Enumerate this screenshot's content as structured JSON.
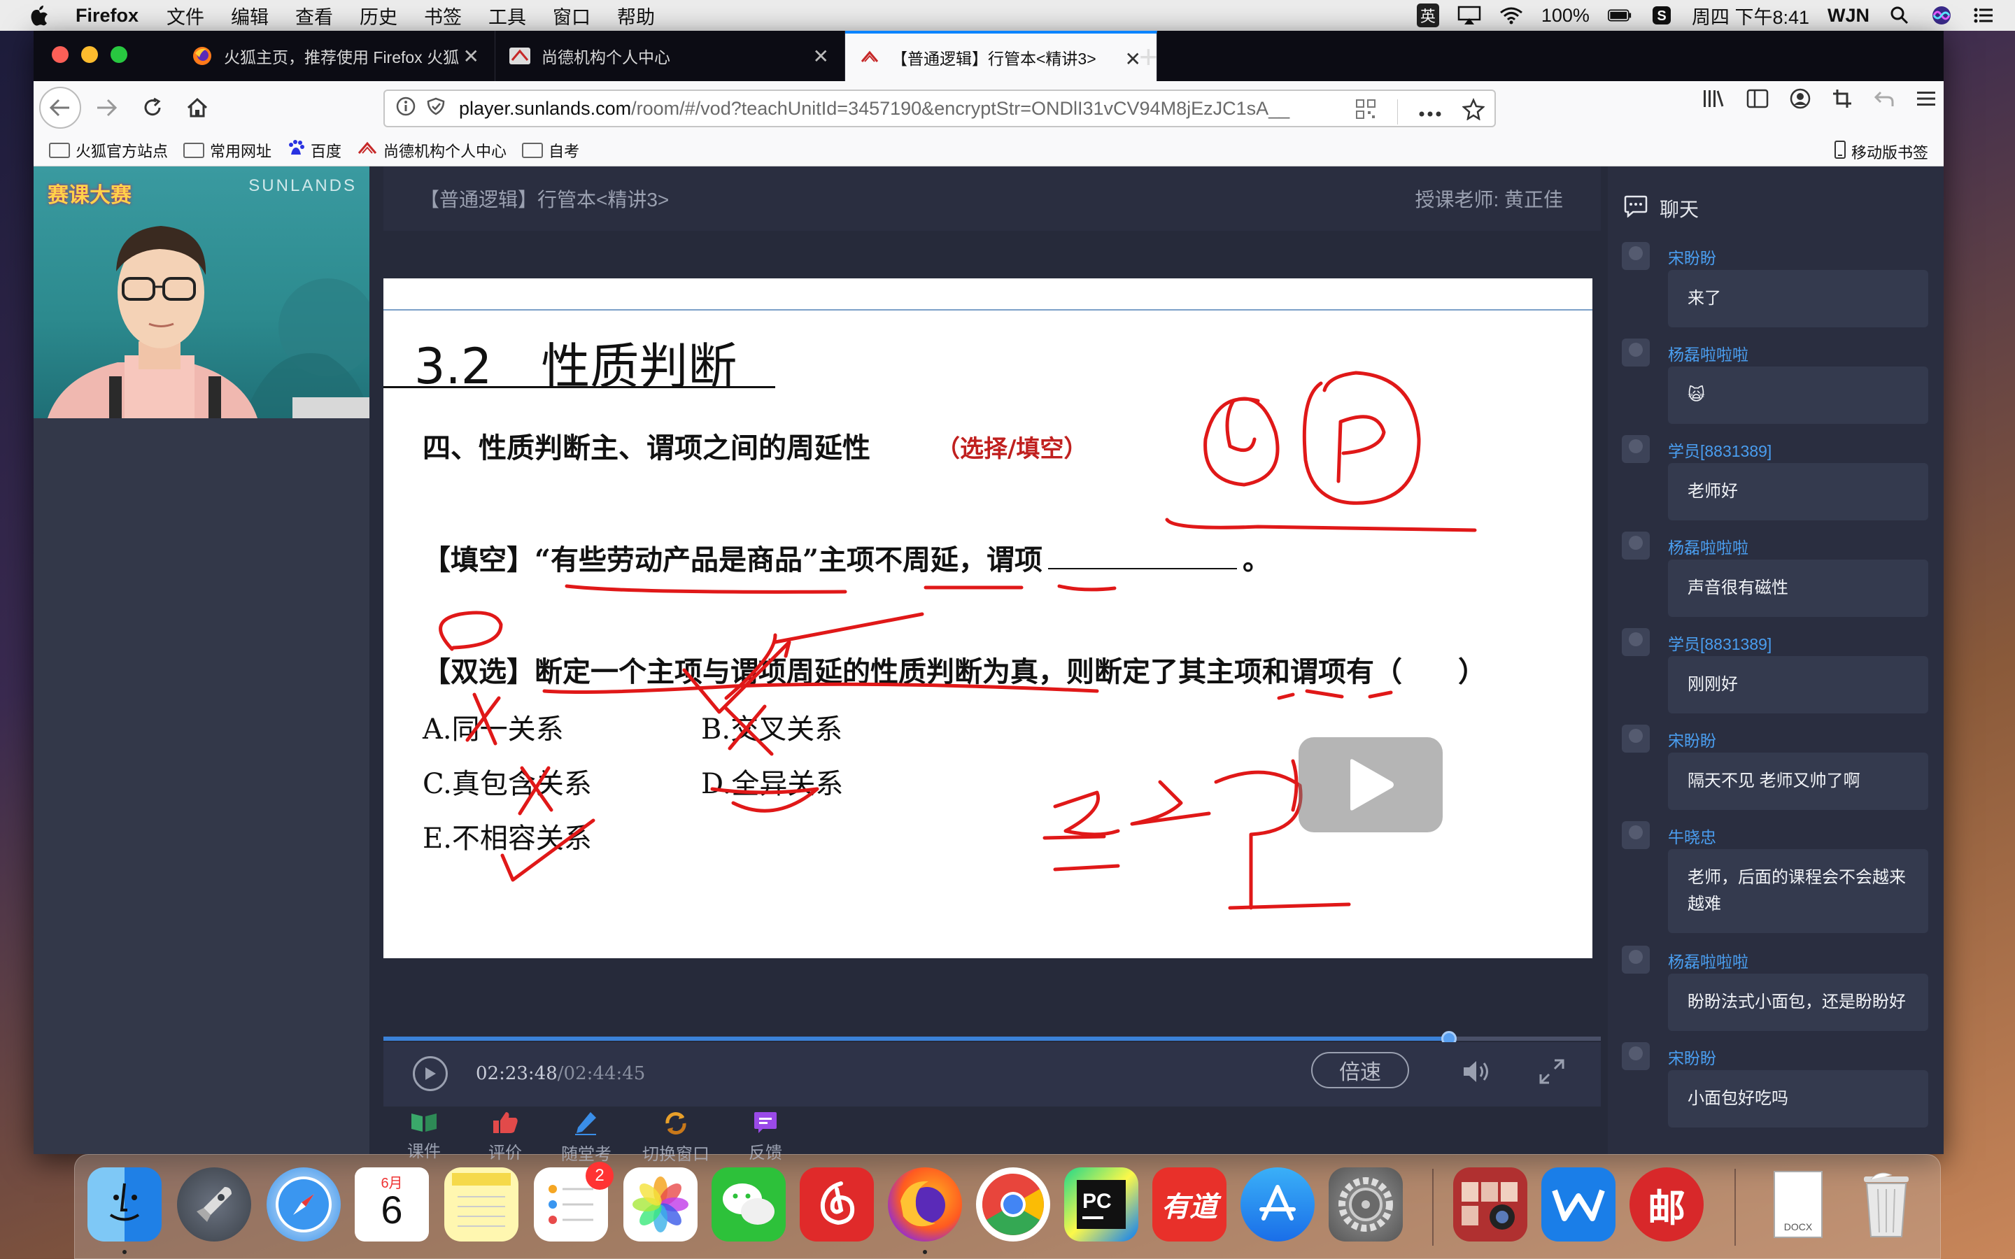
{
  "menubar": {
    "app_name": "Firefox",
    "items": [
      "文件",
      "编辑",
      "查看",
      "历史",
      "书签",
      "工具",
      "窗口",
      "帮助"
    ],
    "ime": "英",
    "battery": "100%",
    "datetime": "周四 下午8:41",
    "user": "WJN"
  },
  "tabs": [
    {
      "title": "火狐主页，推荐使用 Firefox 火狐",
      "active": false
    },
    {
      "title": "尚德机构个人中心",
      "active": false
    },
    {
      "title": "【普通逻辑】行管本<精讲3>",
      "active": true
    }
  ],
  "urlbar": {
    "host": "player.sunlands.com",
    "path": "/room/#/vod?teachUnitId=3457190&encryptStr=ONDlI31vCV94M8jEzJC1sA__"
  },
  "bookmarks": [
    {
      "label": "火狐官方站点",
      "icon": "folder-icon"
    },
    {
      "label": "常用网址",
      "icon": "folder-icon"
    },
    {
      "label": "百度",
      "icon": "baidu-icon"
    },
    {
      "label": "尚德机构个人中心",
      "icon": "sunlands-icon"
    },
    {
      "label": "自考",
      "icon": "folder-icon"
    }
  ],
  "bookmarks_mobile": "移动版书签",
  "webcam": {
    "logo": "赛课大赛",
    "brand": "SUNLANDS"
  },
  "lesson": {
    "title": "【普通逻辑】行管本<精讲3>",
    "teacher": "授课老师: 黄正佳"
  },
  "slide": {
    "heading": "3.2　性质判断",
    "subheading": "四、性质判断主、谓项之间的周延性",
    "subheading_tag": "（选择/填空）",
    "fill_question_prefix": "【填空】“有些劳动产品是商品”主项不周延，谓项",
    "fill_question_suffix": "。",
    "choice_question": "【双选】断定一个主项与谓项周延的性质判断为真，则断定了其主项和谓项有（　　）",
    "options": [
      "A.同一关系",
      "B.交叉关系",
      "C.真包含关系",
      "D.全异关系",
      "E.不相容关系"
    ]
  },
  "player": {
    "progress": 0.875,
    "current_time": "02:23:48",
    "duration": "/02:44:45",
    "speed_label": "倍速"
  },
  "tools": [
    {
      "label": "课件",
      "icon": "book-icon",
      "color": "#3aa86a"
    },
    {
      "label": "评价",
      "icon": "thumbs-up-icon",
      "color": "#e24a4a"
    },
    {
      "label": "随堂考",
      "icon": "pencil-icon",
      "color": "#3a8ee8"
    },
    {
      "label": "切换窗口",
      "icon": "switch-icon",
      "color": "#e8a02a"
    },
    {
      "label": "反馈",
      "icon": "feedback-icon",
      "color": "#9a4ae8"
    }
  ],
  "chat": {
    "title": "聊天",
    "messages": [
      {
        "name": "宋盼盼",
        "text": "来了"
      },
      {
        "name": "杨磊啦啦啦",
        "text": "🙀"
      },
      {
        "name": "学员[8831389]",
        "text": "老师好"
      },
      {
        "name": "杨磊啦啦啦",
        "text": "声音很有磁性"
      },
      {
        "name": "学员[8831389]",
        "text": "刚刚好"
      },
      {
        "name": "宋盼盼",
        "text": "隔天不见 老师又帅了啊"
      },
      {
        "name": "牛晓忠",
        "text": "老师，后面的课程会不会越来越难"
      },
      {
        "name": "杨磊啦啦啦",
        "text": "盼盼法式小面包，还是盼盼好"
      },
      {
        "name": "宋盼盼",
        "text": "小面包好吃吗"
      }
    ]
  },
  "dock": {
    "calendar_month": "6月",
    "calendar_day": "6",
    "reminders_badge": "2",
    "pycharm_label": "PC",
    "youdao_label": "有道",
    "mail_label": "邮",
    "doc_label": "DOCX"
  }
}
